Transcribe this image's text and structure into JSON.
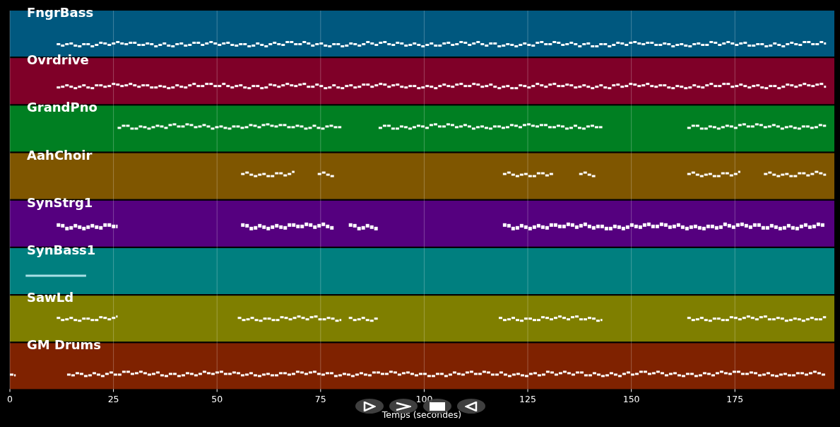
{
  "tracks": [
    {
      "name": "FngrBass",
      "color": "#00587f"
    },
    {
      "name": "Ovrdrive",
      "color": "#7f0028"
    },
    {
      "name": "GrandPno",
      "color": "#007f22"
    },
    {
      "name": "AahChoir",
      "color": "#7f5600"
    },
    {
      "name": "SynStrg1",
      "color": "#55007f"
    },
    {
      "name": "SynBass1",
      "color": "#007f7f"
    },
    {
      "name": "SawLd",
      "color": "#7f7f00"
    },
    {
      "name": "GM Drums",
      "color": "#7f2200"
    }
  ],
  "x_axis": {
    "ticks": [
      "0",
      "25",
      "50",
      "75",
      "100",
      "125",
      "150",
      "175"
    ],
    "label": "Temps (secondes)"
  },
  "controls": [
    {
      "kind": "play"
    },
    {
      "kind": "forward"
    },
    {
      "kind": "stop"
    },
    {
      "kind": "back"
    }
  ]
}
